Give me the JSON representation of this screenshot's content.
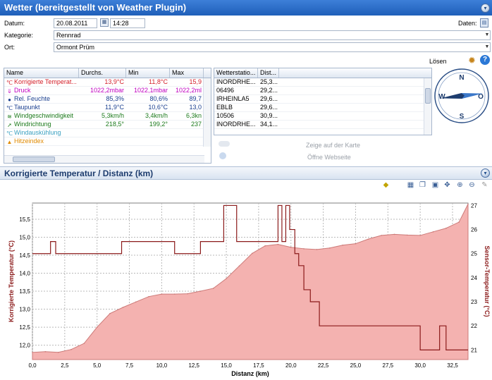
{
  "window": {
    "title": "Wetter (bereitgestellt von Weather Plugin)"
  },
  "form": {
    "datum_label": "Datum:",
    "date_value": "20.08.2011",
    "time_value": "14:28",
    "daten_label": "Daten:",
    "kategorie_label": "Kategorie:",
    "kategorie_value": "Rennrad",
    "ort_label": "Ort:",
    "ort_value": "Ormont Prüm",
    "solve_label": "Lösen"
  },
  "weather_table": {
    "headers": [
      "Name",
      "Durchs.",
      "Min",
      "Max"
    ],
    "rows": [
      {
        "icon": "thermometer-icon",
        "name": "Korrigierte Temperat...",
        "avg": "13,9°C",
        "min": "11,8°C",
        "max": "15,9",
        "color": "#d4202a"
      },
      {
        "icon": "pressure-icon",
        "name": "Druck",
        "avg": "1022,2mbar",
        "min": "1022,1mbar",
        "max": "1022,2ml",
        "color": "#c000c0"
      },
      {
        "icon": "humidity-icon",
        "name": "Rel. Feuchte",
        "avg": "85,3%",
        "min": "80,6%",
        "max": "89,7",
        "color": "#1a3f8f"
      },
      {
        "icon": "dewpoint-icon",
        "name": "Taupunkt",
        "avg": "11,9°C",
        "min": "10,6°C",
        "max": "13,0",
        "color": "#1a3f8f"
      },
      {
        "icon": "windspeed-icon",
        "name": "Windgeschwindigkeit",
        "avg": "5,3km/h",
        "min": "3,4km/h",
        "max": "6,3kn",
        "color": "#1c7a1c"
      },
      {
        "icon": "winddirection-icon",
        "name": "Windrichtung",
        "avg": "218,5°",
        "min": "199,2°",
        "max": "237",
        "color": "#1c7a1c"
      },
      {
        "icon": "windchill-icon",
        "name": "Windauskühlung",
        "avg": "",
        "min": "",
        "max": "",
        "color": "#3aa0c0"
      },
      {
        "icon": "heatindex-icon",
        "name": "Hitzeindex",
        "avg": "",
        "min": "",
        "max": "",
        "color": "#e08a00"
      }
    ]
  },
  "station_table": {
    "headers": [
      "Wetterstatio...",
      "Dist..."
    ],
    "rows": [
      {
        "station": "INORDRHE...",
        "dist": "25,3..."
      },
      {
        "station": "06496",
        "dist": "29,2..."
      },
      {
        "station": "IRHEINLA5",
        "dist": "29,6..."
      },
      {
        "station": "EBLB",
        "dist": "29,6..."
      },
      {
        "station": "10506",
        "dist": "30,9..."
      },
      {
        "station": "INORDRHE...",
        "dist": "34,1..."
      }
    ]
  },
  "links": {
    "map": "Zeige auf der Karte",
    "web": "Öffne Webseite"
  },
  "compass": {
    "n": "N",
    "o": "O",
    "s": "S",
    "w": "W",
    "direction_deg": 218.5
  },
  "chart_section_title": "Korrigierte Temperatur / Distanz (km)",
  "colors": {
    "title_bar": "#2a6cc8",
    "area_fill": "#f4b2b0",
    "area_line": "#cc7a78",
    "sensor_line": "#8b1a1a",
    "axis_label": "#8b1a1a"
  },
  "chart_data": {
    "type": "area",
    "title": "",
    "xlabel": "Distanz (km)",
    "ylabel": "Korrigierte Temperatur (°C)",
    "y2label": "Sensor-Temperatur (°C)",
    "xlim": [
      0,
      33.7
    ],
    "ylim": [
      11.6,
      15.95
    ],
    "y2lim": [
      20.6,
      27.1
    ],
    "x_ticks": [
      "0,0",
      "2,5",
      "5,0",
      "7,5",
      "10,0",
      "12,5",
      "15,0",
      "17,5",
      "20,0",
      "22,5",
      "25,0",
      "27,5",
      "30,0",
      "32,5"
    ],
    "x_tick_values": [
      0,
      2.5,
      5,
      7.5,
      10,
      12.5,
      15,
      17.5,
      20,
      22.5,
      25,
      27.5,
      30,
      32.5
    ],
    "y_ticks": [
      "12,0",
      "12,5",
      "13,0",
      "13,5",
      "14,0",
      "14,5",
      "15,0",
      "15,5"
    ],
    "y_tick_values": [
      12.0,
      12.5,
      13.0,
      13.5,
      14.0,
      14.5,
      15.0,
      15.5
    ],
    "y2_ticks": [
      "21",
      "22",
      "23",
      "24",
      "25",
      "26",
      "27"
    ],
    "y2_tick_values": [
      21,
      22,
      23,
      24,
      25,
      26,
      27
    ],
    "grid": true,
    "series": [
      {
        "name": "Korrigierte Temperatur",
        "axis": "left",
        "x": [
          0,
          1,
          2,
          3,
          4,
          5,
          6,
          7,
          8,
          9,
          10,
          11,
          12,
          13,
          14,
          15,
          16,
          17,
          18,
          19,
          20,
          21,
          22,
          23,
          24,
          25,
          26,
          27,
          28,
          29,
          30,
          31,
          32,
          33,
          33.7
        ],
        "values": [
          11.8,
          11.82,
          11.8,
          11.88,
          12.05,
          12.5,
          12.88,
          13.05,
          13.2,
          13.35,
          13.42,
          13.42,
          13.43,
          13.5,
          13.58,
          13.85,
          14.2,
          14.55,
          14.76,
          14.8,
          14.72,
          14.68,
          14.66,
          14.7,
          14.78,
          14.82,
          14.95,
          15.05,
          15.08,
          15.06,
          15.05,
          15.15,
          15.25,
          15.42,
          15.92
        ]
      },
      {
        "name": "Sensor-Temperatur",
        "axis": "right",
        "x": [
          0,
          1.4,
          1.4,
          1.8,
          1.8,
          6.9,
          6.9,
          11,
          11,
          13,
          13,
          14.8,
          14.8,
          15.8,
          15.8,
          19,
          19,
          19.3,
          19.3,
          19.6,
          19.6,
          19.9,
          19.9,
          20.3,
          20.3,
          20.6,
          20.6,
          21,
          21,
          21.5,
          21.5,
          22.2,
          22.2,
          23.2,
          23.2,
          30,
          30,
          31.5,
          31.5,
          32,
          32,
          33.7
        ],
        "values": [
          25,
          25,
          25.5,
          25.5,
          25,
          25,
          25.5,
          25.5,
          25,
          25,
          25.5,
          25.5,
          27,
          27,
          25.5,
          25.5,
          27,
          27,
          25.5,
          25.5,
          27,
          27,
          26,
          26,
          25,
          25,
          24.5,
          24.5,
          23.5,
          23.5,
          23,
          23,
          22,
          22,
          22,
          22,
          21,
          21,
          22,
          22,
          21,
          21
        ]
      }
    ]
  }
}
